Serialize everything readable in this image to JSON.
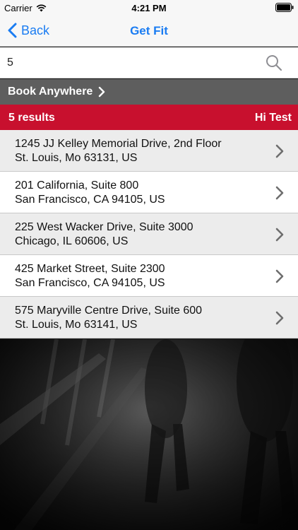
{
  "status_bar": {
    "carrier": "Carrier",
    "time": "4:21 PM"
  },
  "nav": {
    "back_label": "Back",
    "title": "Get Fit"
  },
  "search": {
    "value": "5",
    "placeholder": ""
  },
  "book_anywhere": {
    "label": "Book Anywhere"
  },
  "results": {
    "count_label": "5 results",
    "greeting": "Hi Test"
  },
  "locations": [
    {
      "line1": "1245 JJ Kelley Memorial Drive, 2nd Floor",
      "line2": "St. Louis, Mo 63131, US"
    },
    {
      "line1": "201 California, Suite 800",
      "line2": "San Francisco, CA 94105, US"
    },
    {
      "line1": "225 West Wacker Drive, Suite 3000",
      "line2": "Chicago, IL 60606, US"
    },
    {
      "line1": "425 Market Street, Suite 2300",
      "line2": "San Francisco, CA 94105, US"
    },
    {
      "line1": "575 Maryville Centre Drive, Suite 600",
      "line2": "St. Louis, Mo 63141, US"
    }
  ],
  "colors": {
    "accent_blue": "#1a7cf2",
    "brand_red": "#c8102e",
    "bar_gray": "#5e5e5e"
  },
  "icons": {
    "wifi": "wifi-icon",
    "battery": "battery-icon",
    "back": "chevron-left-icon",
    "search": "search-icon",
    "disclosure": "chevron-right-icon"
  }
}
